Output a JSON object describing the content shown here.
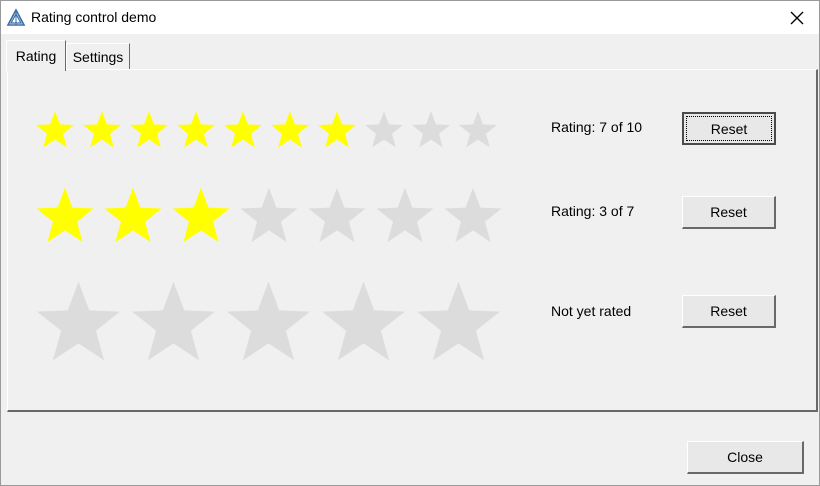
{
  "window": {
    "title": "Rating control demo",
    "close_glyph": "✕"
  },
  "tabs": [
    {
      "label": "Rating",
      "active": true
    },
    {
      "label": "Settings",
      "active": false
    }
  ],
  "ratings": [
    {
      "value": 7,
      "max": 10,
      "label": "Rating: 7 of 10",
      "reset_label": "Reset"
    },
    {
      "value": 3,
      "max": 7,
      "label": "Rating: 3 of 7",
      "reset_label": "Reset"
    },
    {
      "value": 0,
      "max": 5,
      "label": "Not yet rated",
      "reset_label": "Reset"
    }
  ],
  "footer": {
    "close_label": "Close"
  },
  "colors": {
    "star_filled": "#ffff00",
    "star_empty": "#dcdcdc"
  }
}
